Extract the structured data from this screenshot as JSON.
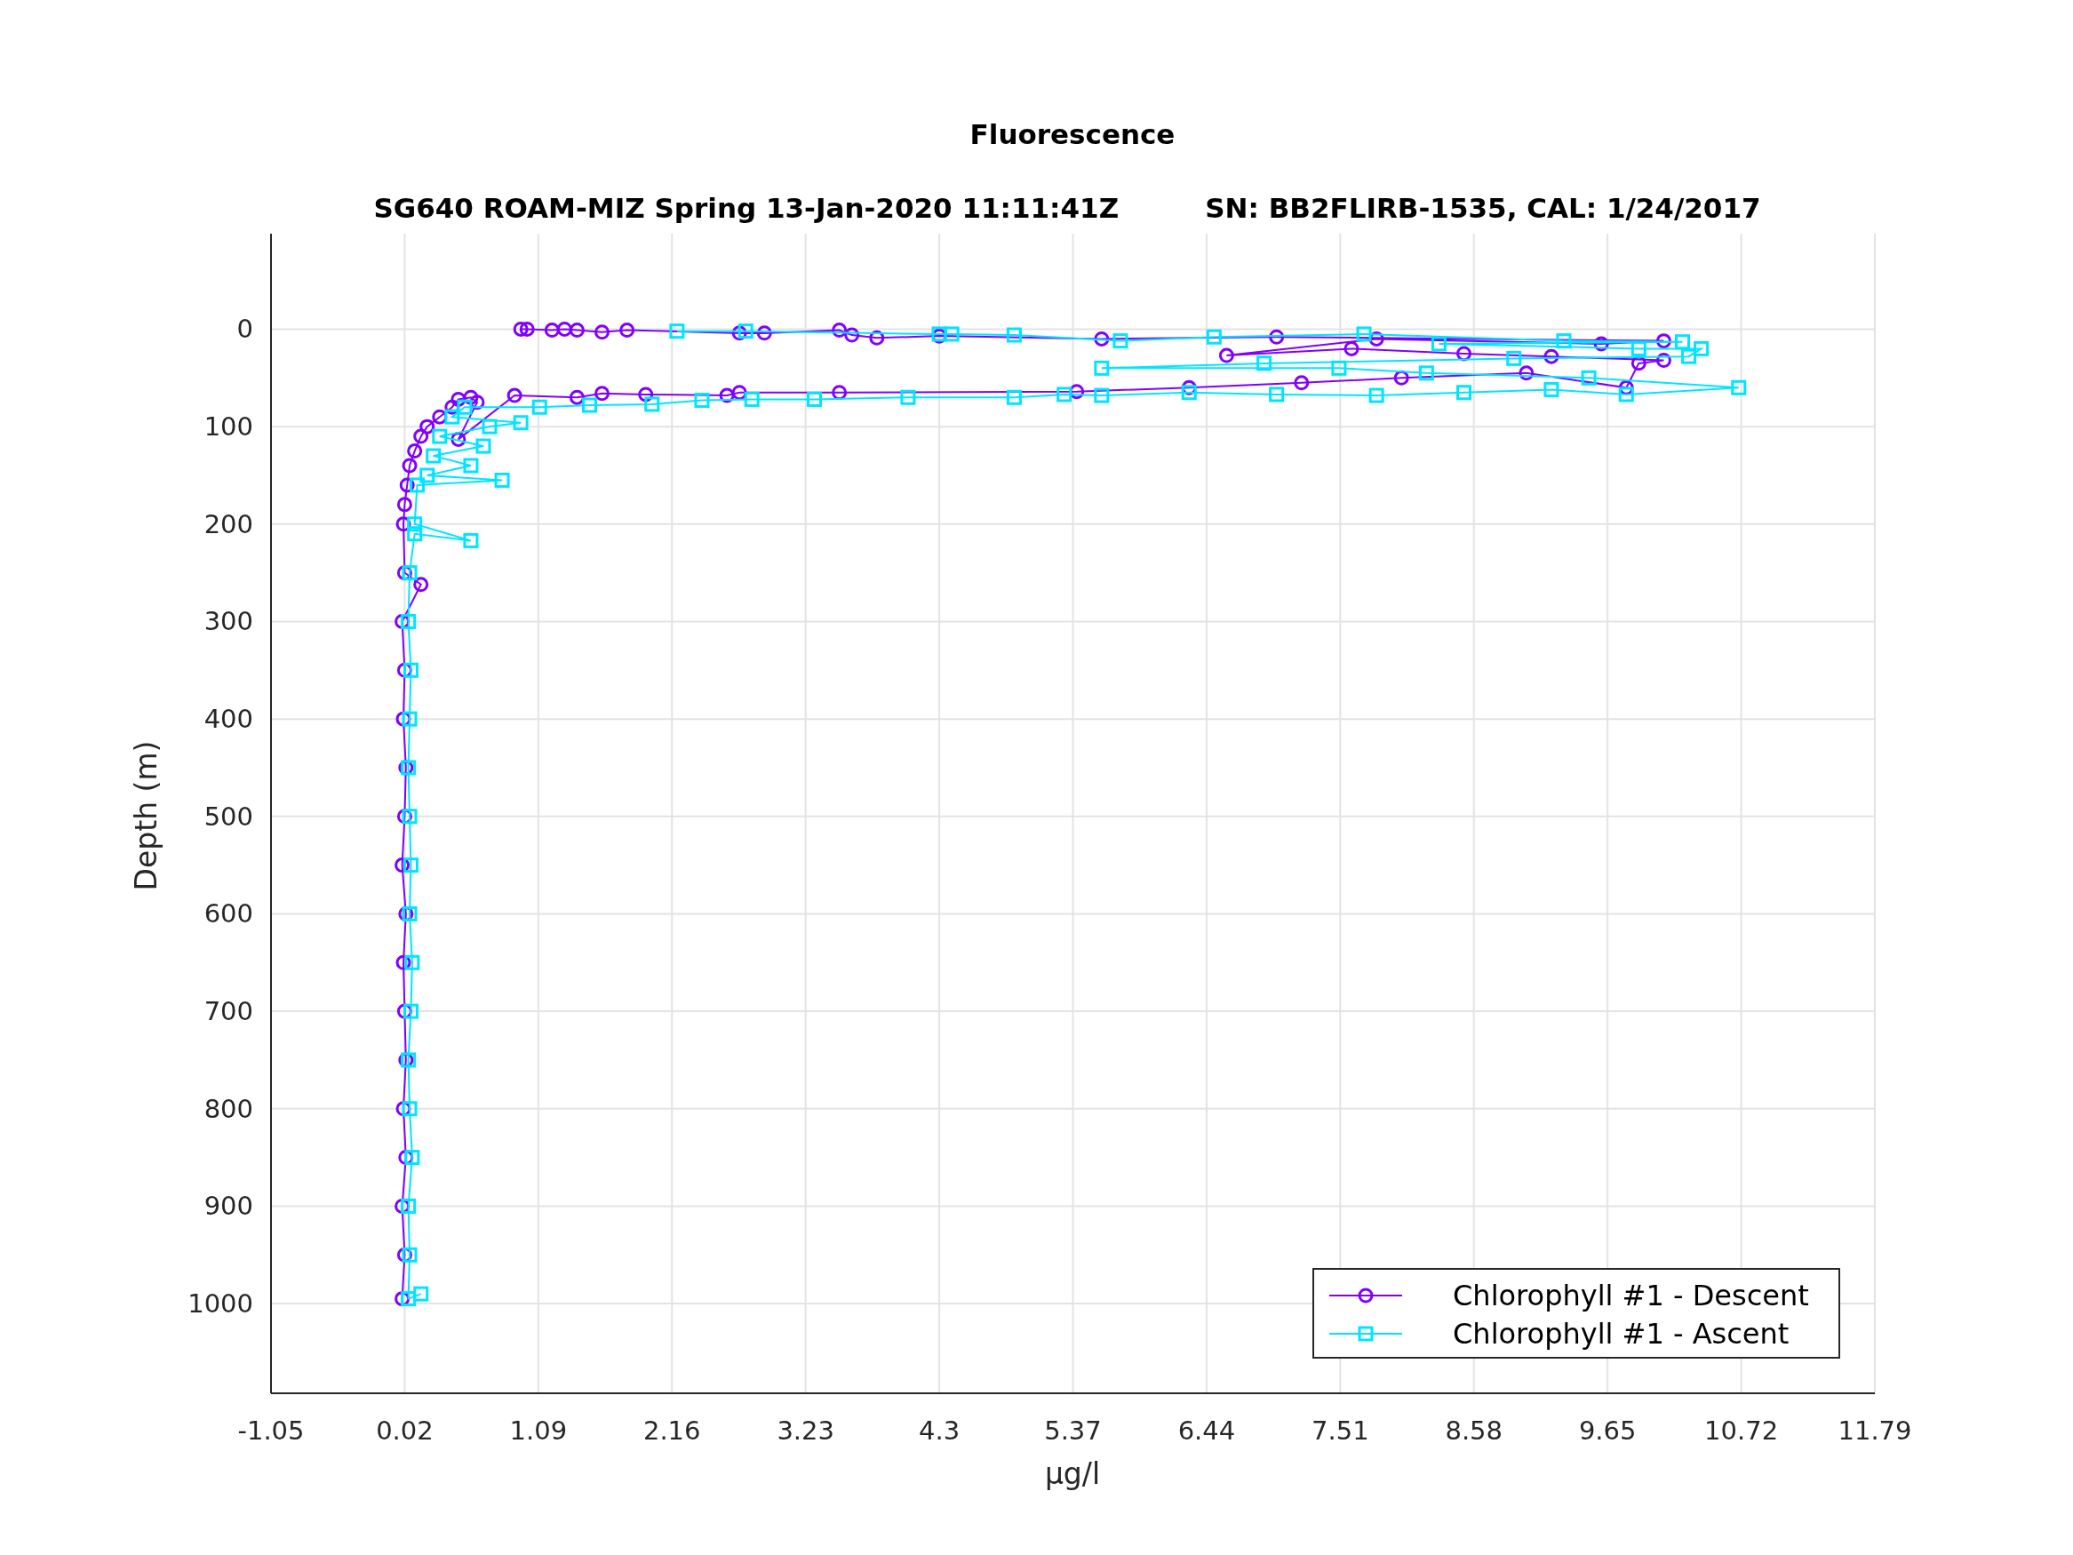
{
  "figure": {
    "legend": true,
    "subtitle": "SG640 ROAM-MIZ Spring 13-Jan-2020 11:11:41Z         SN: BB2FLIRB-1535, CAL: 1/24/2017",
    "chart_data": {
      "type": "line",
      "grid": true,
      "title": "Fluorescence",
      "xlabel": "μg/l",
      "ylabel": "Depth (m)",
      "xlim": [
        -1.05,
        11.79
      ],
      "ylim": [
        1092,
        -98
      ],
      "xticks": [
        {
          "value": -1.05,
          "label": "-1.05"
        },
        {
          "value": 0.02,
          "label": "0.02"
        },
        {
          "value": 1.09,
          "label": "1.09"
        },
        {
          "value": 2.16,
          "label": "2.16"
        },
        {
          "value": 3.23,
          "label": "3.23"
        },
        {
          "value": 4.3,
          "label": "4.3"
        },
        {
          "value": 5.37,
          "label": "5.37"
        },
        {
          "value": 6.44,
          "label": "6.44"
        },
        {
          "value": 7.51,
          "label": "7.51"
        },
        {
          "value": 8.58,
          "label": "8.58"
        },
        {
          "value": 9.65,
          "label": "9.65"
        },
        {
          "value": 10.72,
          "label": "10.72"
        },
        {
          "value": 11.79,
          "label": "11.79"
        }
      ],
      "yticks": [
        {
          "value": 0,
          "label": "0"
        },
        {
          "value": 100,
          "label": "100"
        },
        {
          "value": 200,
          "label": "200"
        },
        {
          "value": 300,
          "label": "300"
        },
        {
          "value": 400,
          "label": "400"
        },
        {
          "value": 500,
          "label": "500"
        },
        {
          "value": 600,
          "label": "600"
        },
        {
          "value": 700,
          "label": "700"
        },
        {
          "value": 800,
          "label": "800"
        },
        {
          "value": 900,
          "label": "900"
        },
        {
          "value": 1000,
          "label": "1000"
        }
      ],
      "series": [
        {
          "name": "Chlorophyll #1 - Descent",
          "color": "#8000ff",
          "marker": "circle",
          "x": [
            0.0,
            0.02,
            0.0,
            0.03,
            0.01,
            0.03,
            0.02,
            0.01,
            0.03,
            0.0,
            0.02,
            0.03,
            0.01,
            0.02,
            0.0,
            0.15,
            0.02,
            0.01,
            0.02,
            0.04,
            0.06,
            0.1,
            0.15,
            0.2,
            0.3,
            0.4,
            0.45,
            0.55,
            0.6,
            0.45,
            0.9,
            1.4,
            1.6,
            1.95,
            2.6,
            2.7,
            3.5,
            5.4,
            6.3,
            7.2,
            8.0,
            9.0,
            9.8,
            9.9,
            10.1,
            9.2,
            8.5,
            7.6,
            6.6,
            7.8,
            9.6,
            10.1,
            7.0,
            5.6,
            4.3,
            3.8,
            3.6,
            3.5,
            2.9,
            2.7,
            1.8,
            1.6,
            1.4,
            1.3,
            1.2,
            1.0,
            0.95
          ],
          "values": [
            995,
            950,
            900,
            850,
            800,
            750,
            700,
            650,
            600,
            550,
            500,
            450,
            400,
            350,
            300,
            262,
            250,
            200,
            180,
            160,
            140,
            125,
            110,
            100,
            90,
            80,
            72,
            70,
            75,
            113,
            68,
            70,
            66,
            67,
            68,
            65,
            65,
            64,
            60,
            55,
            50,
            45,
            60,
            35,
            32,
            28,
            25,
            20,
            27,
            10,
            15,
            12,
            8,
            10,
            7,
            9,
            6,
            1,
            4,
            4,
            1,
            3,
            1,
            0,
            1,
            0,
            0
          ]
        },
        {
          "name": "Chlorophyll #1 - Ascent",
          "color": "#00e5ff",
          "marker": "square",
          "x": [
            0.15,
            0.05,
            0.06,
            0.05,
            0.08,
            0.06,
            0.05,
            0.07,
            0.08,
            0.06,
            0.07,
            0.06,
            0.05,
            0.06,
            0.07,
            0.05,
            0.06,
            0.1,
            0.55,
            0.1,
            0.12,
            0.8,
            0.2,
            0.55,
            0.25,
            0.65,
            0.3,
            0.7,
            0.95,
            0.4,
            0.5,
            1.1,
            1.5,
            2.0,
            2.4,
            2.8,
            3.3,
            4.05,
            4.9,
            5.3,
            5.6,
            6.3,
            7.0,
            7.8,
            8.5,
            9.2,
            9.8,
            10.7,
            9.5,
            8.2,
            7.5,
            5.6,
            6.9,
            8.9,
            10.3,
            10.4,
            9.9,
            8.3,
            10.25,
            9.3,
            7.7,
            6.5,
            5.75,
            4.9,
            4.4,
            4.3,
            2.75,
            2.2
          ],
          "values": [
            990,
            995,
            950,
            900,
            850,
            800,
            750,
            700,
            650,
            600,
            550,
            500,
            450,
            400,
            350,
            300,
            250,
            210,
            217,
            200,
            160,
            155,
            150,
            140,
            130,
            120,
            110,
            100,
            96,
            90,
            80,
            80,
            78,
            77,
            73,
            72,
            72,
            70,
            70,
            67,
            68,
            65,
            67,
            68,
            65,
            62,
            67,
            60,
            50,
            45,
            40,
            40,
            35,
            30,
            28,
            20,
            20,
            15,
            13,
            12,
            5,
            8,
            12,
            6,
            5,
            5,
            2,
            2
          ]
        }
      ]
    }
  }
}
